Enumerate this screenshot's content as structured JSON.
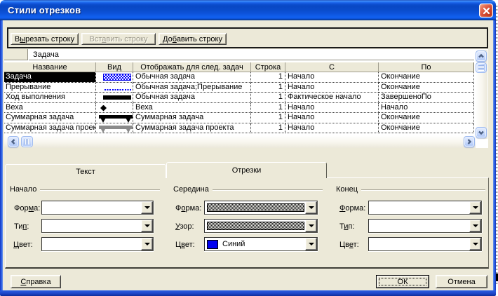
{
  "window": {
    "title": "Стили отрезков"
  },
  "colors": {
    "face": "#ECE9D8",
    "selection": "#000000",
    "task_bar_blue": "#0000FF",
    "project_summary_gray": "#8A8A8A"
  },
  "toolbar": {
    "cut_row": {
      "pre": "В",
      "ac": "ы",
      "post": "резать строку"
    },
    "insert_row": {
      "pre": "Вст",
      "ac": "а",
      "post": "вить строку"
    },
    "add_row": {
      "pre": "До",
      "ac": "б",
      "post": "авить строку"
    }
  },
  "entry_bar": {
    "value": "Задача"
  },
  "table": {
    "headers": [
      "Название",
      "Вид",
      "Отображать для след. задач",
      "Строка",
      "С",
      "По"
    ],
    "rows": [
      {
        "name": "Задача",
        "shape": "blue-hatched-bar",
        "show_for": "Обычная задача",
        "row": "1",
        "from": "Начало",
        "to": "Окончание",
        "selected": true
      },
      {
        "name": "Прерывание",
        "shape": "blue-dotted-line",
        "show_for": "Обычная задача;Прерывание",
        "row": "1",
        "from": "Начало",
        "to": "Окончание",
        "selected": false
      },
      {
        "name": "Ход выполнения",
        "shape": "black-bar",
        "show_for": "Обычная задача",
        "row": "1",
        "from": "Фактическое начало",
        "to": "ЗавершеноПо",
        "selected": false
      },
      {
        "name": "Веха",
        "shape": "black-diamond",
        "show_for": "Веха",
        "row": "1",
        "from": "Начало",
        "to": "Начало",
        "selected": false
      },
      {
        "name": "Суммарная задача",
        "shape": "black-summary-bar",
        "show_for": "Суммарная задача",
        "row": "1",
        "from": "Начало",
        "to": "Окончание",
        "selected": false
      },
      {
        "name": "Суммарная задача проек",
        "shape": "gray-summary-bar",
        "show_for": "Суммарная задача проекта",
        "row": "1",
        "from": "Начало",
        "to": "Окончание",
        "selected": false
      }
    ]
  },
  "tabs": [
    {
      "label": "Текст",
      "active": false
    },
    {
      "label": "Отрезки",
      "active": true
    }
  ],
  "groups": {
    "start": {
      "title": "Начало",
      "shape_label": {
        "pre": "Фор",
        "ac": "м",
        "post": "а:"
      },
      "type_label": {
        "pre": "Ти",
        "ac": "п",
        "post": ":"
      },
      "color_label": {
        "pre": "",
        "ac": "Ц",
        "post": "вет:"
      },
      "shape_value": "",
      "type_value": "",
      "color_value": ""
    },
    "middle": {
      "title": "Середина",
      "shape_label": {
        "pre": "Ф",
        "ac": "о",
        "post": "рма:"
      },
      "pattern_label": {
        "pre": "",
        "ac": "У",
        "post": "зор:"
      },
      "color_label": {
        "pre": "Ц",
        "ac": "в",
        "post": "ет:"
      },
      "shape_value": "hatched-bar",
      "pattern_value": "hatched-pattern",
      "color_value": "Синий",
      "color_hex": "#0000FF"
    },
    "end": {
      "title": "Конец",
      "shape_label": {
        "pre": "",
        "ac": "Ф",
        "post": "орма:"
      },
      "type_label": {
        "pre": "Т",
        "ac": "и",
        "post": "п:"
      },
      "color_label": {
        "pre": "Цв",
        "ac": "е",
        "post": "т:"
      },
      "shape_value": "",
      "type_value": "",
      "color_value": ""
    }
  },
  "footer": {
    "help": {
      "pre": "",
      "ac": "С",
      "post": "правка"
    },
    "ok": "ОК",
    "cancel": "Отмена"
  }
}
